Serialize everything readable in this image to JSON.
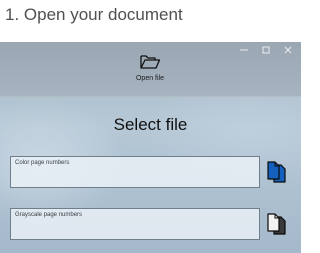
{
  "step": {
    "title": "1. Open your document"
  },
  "window": {
    "controls": {
      "minimize_icon": "minimize-icon",
      "maximize_icon": "maximize-icon",
      "close_icon": "close-icon"
    },
    "toolbar": {
      "open_file_label": "Open file",
      "open_file_icon": "folder-open-icon"
    },
    "main": {
      "heading": "Select file",
      "color_field": {
        "label": "Color page numbers",
        "value": "",
        "button_icon": "color-pages-icon",
        "button_color": "#1560bd"
      },
      "grayscale_field": {
        "label": "Grayscale page numbers",
        "value": "",
        "button_icon": "grayscale-pages-icon",
        "button_color": "#3a3a3a"
      }
    }
  }
}
